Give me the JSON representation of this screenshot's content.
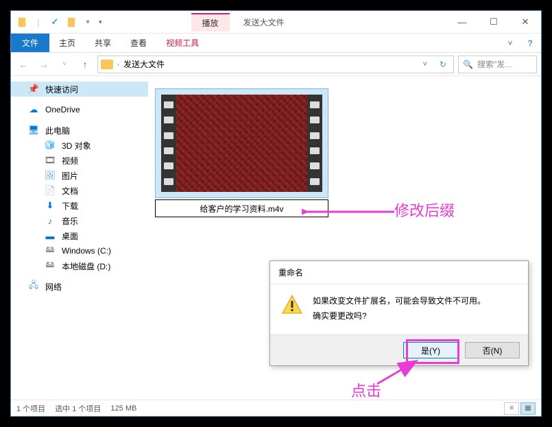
{
  "window_title": "发送大文件",
  "play_tab": "播放",
  "ribbon": {
    "file": "文件",
    "home": "主页",
    "share": "共享",
    "view": "查看",
    "video_tools": "视频工具"
  },
  "path": {
    "current": "发送大文件"
  },
  "search": {
    "placeholder": "搜索\"发..."
  },
  "sidebar": {
    "quick_access": "快速访问",
    "onedrive": "OneDrive",
    "this_pc": "此电脑",
    "objects_3d": "3D 对象",
    "videos": "视频",
    "pictures": "图片",
    "documents": "文档",
    "downloads": "下载",
    "music": "音乐",
    "desktop": "桌面",
    "drive_c": "Windows (C:)",
    "drive_d": "本地磁盘 (D:)",
    "network": "网络"
  },
  "file": {
    "name": "给客户的学习资料.m4v"
  },
  "status": {
    "count": "1 个项目",
    "selection": "选中 1 个项目",
    "size": "125 MB"
  },
  "dialog": {
    "title": "重命名",
    "line1": "如果改变文件扩展名，可能会导致文件不可用。",
    "line2": "确实要更改吗?",
    "yes": "是(Y)",
    "no": "否(N)"
  },
  "annotations": {
    "modify_ext": "修改后缀",
    "click": "点击"
  }
}
